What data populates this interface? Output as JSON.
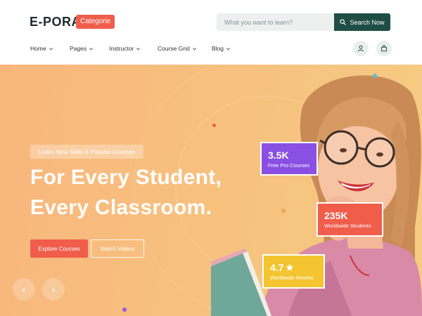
{
  "header": {
    "logo": "E-PORA.",
    "category_button": "Categorie",
    "search": {
      "placeholder": "What you want to learn?",
      "button": "Search Now"
    },
    "nav": [
      {
        "label": "Home"
      },
      {
        "label": "Pages"
      },
      {
        "label": "Instructor"
      },
      {
        "label": "Course Grid"
      },
      {
        "label": "Blog"
      }
    ],
    "icons": [
      "user-icon",
      "shopping-bag-icon",
      "search-icon"
    ]
  },
  "hero": {
    "badge": "Learn New Skills & Popular Courses",
    "headline_line1": "For Every Student,",
    "headline_line2": "Every Classroom.",
    "primary_button": "Explore Courses",
    "secondary_button": "Watch Videos",
    "slider_prev": "‹",
    "slider_next": "›"
  },
  "stats": [
    {
      "value": "3.5K",
      "label": "Free Pro Courses",
      "color": "#8a4fe3"
    },
    {
      "value": "235K",
      "label": "Worldwide Students",
      "color": "#f05d4b"
    },
    {
      "value": "4.7",
      "label": "Worldwide Review",
      "color": "#f4c431",
      "icon": "star-icon"
    }
  ],
  "colors": {
    "brand_dark": "#1f4d45",
    "accent_red": "#f05d4b",
    "hero_gradient_start": "#f8b67d",
    "hero_gradient_end": "#f5cc82"
  }
}
